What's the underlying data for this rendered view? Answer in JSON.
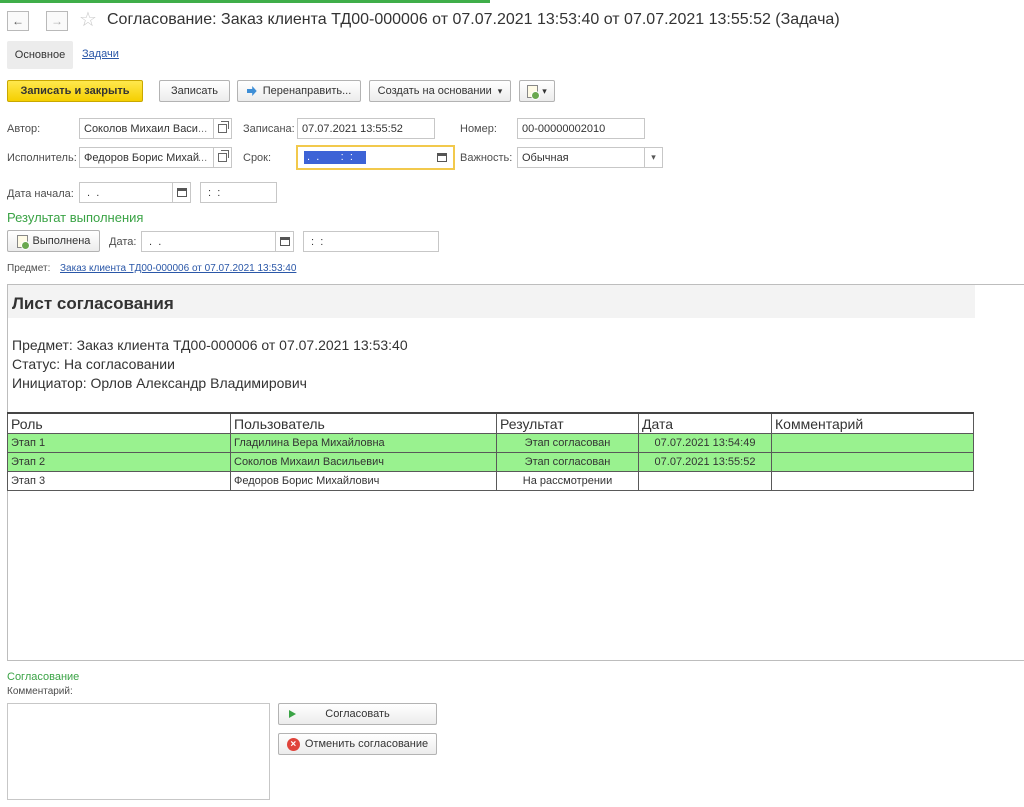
{
  "window": {
    "title": "Согласование: Заказ клиента ТД00-000006 от 07.07.2021 13:53:40 от 07.07.2021 13:55:52 (Задача)",
    "back_icon": "←",
    "forward_icon": "→",
    "star_icon": "☆"
  },
  "tabs": {
    "main": "Основное",
    "tasks": "Задачи"
  },
  "toolbar": {
    "save_close": "Записать и закрыть",
    "save": "Записать",
    "redirect": "Перенаправить...",
    "create_based": "Создать на основании",
    "dropdown_arrow": "▾"
  },
  "form": {
    "author_label": "Автор:",
    "author_value": "Соколов Михаил Васи",
    "written_label": "Записана:",
    "written_value": "07.07.2021 13:55:52",
    "number_label": "Номер:",
    "number_value": "00-00000002010",
    "executor_label": "Исполнитель:",
    "executor_value": "Федоров Борис Михай",
    "deadline_label": "Срок:",
    "deadline_value": " .  .       :  :",
    "importance_label": "Важность:",
    "importance_value": "Обычная",
    "start_label": "Дата начала:",
    "start_date": " .  .",
    "start_time": " :  :",
    "ellipsis": "...",
    "select_arrow": "▾"
  },
  "result": {
    "heading": "Результат выполнения",
    "done_button": "Выполнена",
    "date_label": "Дата:",
    "date_value": " .  .",
    "time_value": " :  :"
  },
  "subject": {
    "label": "Предмет:",
    "link": "Заказ клиента ТД00-000006 от 07.07.2021 13:53:40"
  },
  "sheet": {
    "title": "Лист согласования",
    "subject_line": "Предмет: Заказ клиента ТД00-000006 от 07.07.2021 13:53:40",
    "status_line": "Статус: На согласовании",
    "initiator_line": "Инициатор: Орлов Александр Владимирович",
    "columns": [
      "Роль",
      "Пользователь",
      "Результат",
      "Дата",
      "Комментарий"
    ],
    "rows": [
      {
        "role": "Этап 1",
        "user": "Гладилина Вера Михайловна",
        "result": "Этап согласован",
        "date": "07.07.2021 13:54:49",
        "comment": "",
        "done": true
      },
      {
        "role": "Этап 2",
        "user": "Соколов Михаил Васильевич",
        "result": "Этап согласован",
        "date": "07.07.2021 13:55:52",
        "comment": "",
        "done": true
      },
      {
        "role": "Этап 3",
        "user": "Федоров Борис Михайлович",
        "result": "На рассмотрении",
        "date": "",
        "comment": "",
        "done": false
      }
    ]
  },
  "approval": {
    "heading": "Согласование",
    "comment_label": "Комментарий:",
    "approve_button": "Согласовать",
    "cancel_button": "Отменить согласование"
  },
  "colors": {
    "accent_green": "#3aa345",
    "approved_row": "#99f28f",
    "primary_button": "#f5cf00",
    "link": "#2a57a8",
    "deadline_selection": "#3d63d6"
  }
}
